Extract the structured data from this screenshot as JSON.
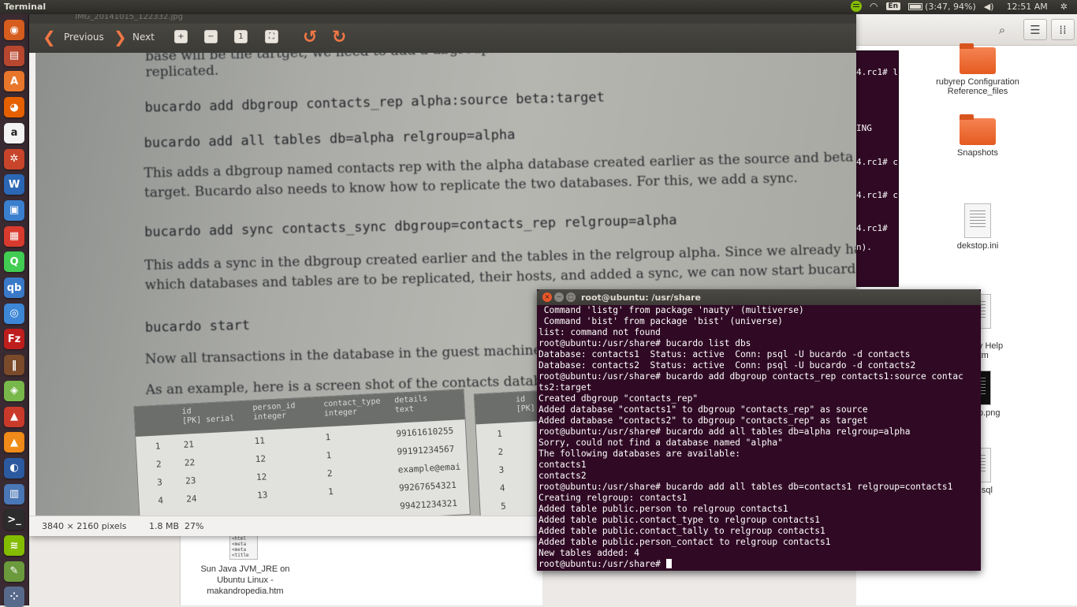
{
  "top_panel": {
    "app_title": "Terminal",
    "keyboard_layout": "En",
    "battery": "(3:47, 94%)",
    "clock": "12:51 AM"
  },
  "launcher": {
    "items": [
      {
        "name": "ubuntu-dash-icon",
        "glyph": "◉",
        "color": "#d55d1e"
      },
      {
        "name": "files-icon",
        "glyph": "▤",
        "color": "#b8472f"
      },
      {
        "name": "software-center-icon",
        "glyph": "A",
        "color": "#e9772b"
      },
      {
        "name": "firefox-icon",
        "glyph": "◕",
        "color": "#e66000"
      },
      {
        "name": "amazon-icon",
        "glyph": "a",
        "color": "#f3f3f3"
      },
      {
        "name": "settings-icon",
        "glyph": "✲",
        "color": "#c8452b"
      },
      {
        "name": "writer-icon",
        "glyph": "W",
        "color": "#2b67b4"
      },
      {
        "name": "virtualbox-icon",
        "glyph": "▣",
        "color": "#3b7fcf"
      },
      {
        "name": "mosaic-icon",
        "glyph": "▦",
        "color": "#d83b2e"
      },
      {
        "name": "qt-creator-icon",
        "glyph": "Q",
        "color": "#41cd52"
      },
      {
        "name": "qbittorrent-icon",
        "glyph": "qb",
        "color": "#3a79c8"
      },
      {
        "name": "chromium-icon",
        "glyph": "◎",
        "color": "#3d87d6"
      },
      {
        "name": "filezilla-icon",
        "glyph": "Fz",
        "color": "#bf1e1e"
      },
      {
        "name": "library-icon",
        "glyph": "‖",
        "color": "#7b4a2a"
      },
      {
        "name": "map-icon",
        "glyph": "◈",
        "color": "#78b84a"
      },
      {
        "name": "installer-icon",
        "glyph": "▲",
        "color": "#ca3a2a"
      },
      {
        "name": "vlc-icon",
        "glyph": "▲",
        "color": "#f08a18"
      },
      {
        "name": "eclipse-icon",
        "glyph": "◐",
        "color": "#2c5aa0"
      },
      {
        "name": "remote-desktop-icon",
        "glyph": "▥",
        "color": "#4a77b5"
      },
      {
        "name": "terminal-icon",
        "glyph": ">_",
        "color": "#2c2c2c"
      },
      {
        "name": "spotify-icon",
        "glyph": "≋",
        "color": "#84bd00"
      },
      {
        "name": "tools-icon",
        "glyph": "✎",
        "color": "#6b9a3d"
      },
      {
        "name": "workspace-icon",
        "glyph": "⁘",
        "color": "#586a8c"
      }
    ]
  },
  "viewer": {
    "title": "IMG_20141015_122332.jpg",
    "previous_label": "Previous",
    "next_label": "Next",
    "status": {
      "dimensions": "3840 × 2160 pixels",
      "size": "1.8 MB",
      "zoom": "27%"
    },
    "photo": {
      "line_a": "base will be the tartget, we need to add a dbgroup. We also need to specify which tables need to be",
      "line_b": "replicated.",
      "cmd1": "bucardo add dbgroup contacts_rep alpha:source beta:target",
      "cmd2": "bucardo add all tables db=alpha relgroup=alpha",
      "para1_a": "This adds a dbgroup named contacts rep with the alpha database created earlier as the source and beta as the",
      "para1_b": "target.  Bucardo also needs to know how to replicate the two databases. For this, we add a sync.",
      "cmd3": "bucardo add sync contacts_sync dbgroup=contacts_rep relgroup=alpha",
      "para2_a": "This adds a sync in the dbgroup created earlier and the tables in the relgroup alpha. Since we already have set up",
      "para2_b": "which databases and tables are to be replicated, their hosts, and added a sync, we can now start bucardo.",
      "cmd4": "bucardo start",
      "para3": "Now all transactions in the database in the guest machine will b",
      "para4": "As an example, here is a screen shot of the contacts database in",
      "table_headers": [
        "id\n[PK] serial",
        "person_id\ninteger",
        "contact_type\ninteger",
        "details\ntext"
      ],
      "table_rows": [
        [
          "1",
          "21",
          "11",
          "1",
          "99161610255"
        ],
        [
          "2",
          "22",
          "12",
          "1",
          "99191234567"
        ],
        [
          "3",
          "23",
          "12",
          "2",
          "example@emai"
        ],
        [
          "4",
          "24",
          "13",
          "1",
          "99267654321"
        ],
        [
          "",
          "",
          "",
          "",
          "99421234321"
        ]
      ],
      "table2_header": "id\n[PK]",
      "table2_rows": [
        "1",
        "2",
        "3",
        "4",
        "5"
      ]
    }
  },
  "files": {
    "items": [
      {
        "label": "rubyrep  Configuration Reference_files",
        "type": "folder"
      },
      {
        "label": "Snapshots",
        "type": "folder"
      },
      {
        "label": "dekstop.ini",
        "type": "doc"
      },
      {
        "label": "...nunity Help\n...htm",
        "type": "doc"
      },
      {
        "label": "...sktop.png",
        "type": "image"
      },
      {
        "label": "...es.sql",
        "type": "doc"
      }
    ],
    "lower_item_label": "Sun Java JVM_JRE on Ubuntu Linux - makandropedia.htm",
    "lower_item_thumb": "<html\n<meta\n<meta\n<title"
  },
  "bg_terminal": {
    "lines": [
      "4.rc1# l",
      "ING",
      "4.rc1# c",
      "4.rc1# c",
      "4.rc1# ",
      "n)."
    ]
  },
  "terminal": {
    "title": "root@ubuntu: /usr/share",
    "lines": [
      " Command 'listg' from package 'nauty' (multiverse)",
      " Command 'bist' from package 'bist' (universe)",
      "list: command not found",
      "root@ubuntu:/usr/share# bucardo list dbs",
      "Database: contacts1  Status: active  Conn: psql -U bucardo -d contacts",
      "Database: contacts2  Status: active  Conn: psql -U bucardo -d contacts2",
      "root@ubuntu:/usr/share# bucardo add dbgroup contacts_rep contacts1:source contac",
      "ts2:target",
      "Created dbgroup \"contacts_rep\"",
      "Added database \"contacts1\" to dbgroup \"contacts_rep\" as source",
      "Added database \"contacts2\" to dbgroup \"contacts_rep\" as target",
      "root@ubuntu:/usr/share# bucardo add all tables db=alpha relgroup=alpha",
      "Sorry, could not find a database named \"alpha\"",
      "The following databases are available:",
      "contacts1",
      "contacts2",
      "root@ubuntu:/usr/share# bucardo add all tables db=contacts1 relgroup=contacts1",
      "Creating relgroup: contacts1",
      "Added table public.person to relgroup contacts1",
      "Added table public.contact_type to relgroup contacts1",
      "Added table public.contact_tally to relgroup contacts1",
      "Added table public.person_contact to relgroup contacts1",
      "New tables added: 4"
    ],
    "prompt": "root@ubuntu:/usr/share# "
  }
}
